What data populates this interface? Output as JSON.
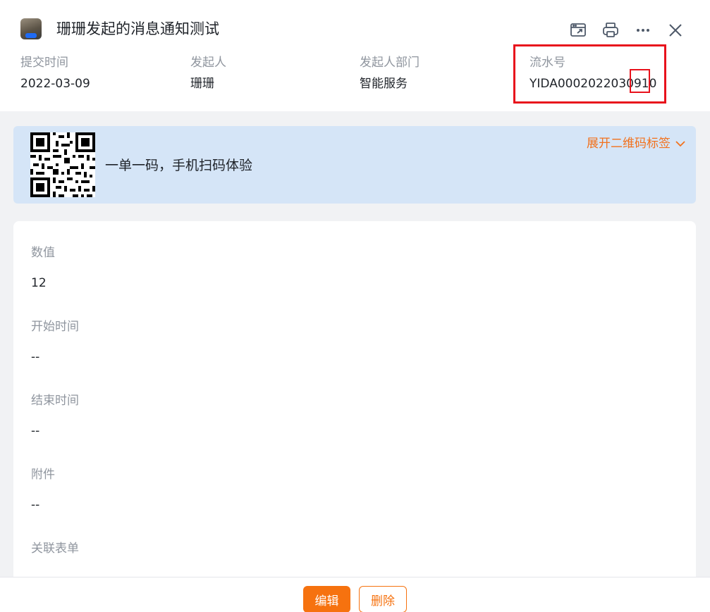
{
  "header": {
    "title": "珊珊发起的消息通知测试",
    "toolbar": [
      {
        "icon": "open-in-new-window-icon"
      },
      {
        "icon": "print-icon"
      },
      {
        "icon": "more-icon"
      },
      {
        "icon": "close-icon"
      }
    ]
  },
  "meta": {
    "submit_time": {
      "label": "提交时间",
      "value": "2022-03-09"
    },
    "initiator": {
      "label": "发起人",
      "value": "珊珊"
    },
    "department": {
      "label": "发起人部门",
      "value": "智能服务"
    },
    "serial": {
      "label": "流水号",
      "value": "YIDA0002022030910"
    }
  },
  "qr_banner": {
    "text": "一单一码，手机扫码体验",
    "expand_label": "展开二维码标签",
    "expand_icon": "chevron-down-icon"
  },
  "form": {
    "fields": [
      {
        "label": "数值",
        "value": "12"
      },
      {
        "label": "开始时间",
        "value": "--"
      },
      {
        "label": "结束时间",
        "value": "--"
      },
      {
        "label": "附件",
        "value": "--"
      },
      {
        "label": "关联表单",
        "value": "--"
      }
    ]
  },
  "footer": {
    "edit_label": "编辑",
    "delete_label": "删除"
  },
  "colors": {
    "accent": "#f6720f",
    "highlight": "#e8121c",
    "banner": "#d5e5f7"
  }
}
